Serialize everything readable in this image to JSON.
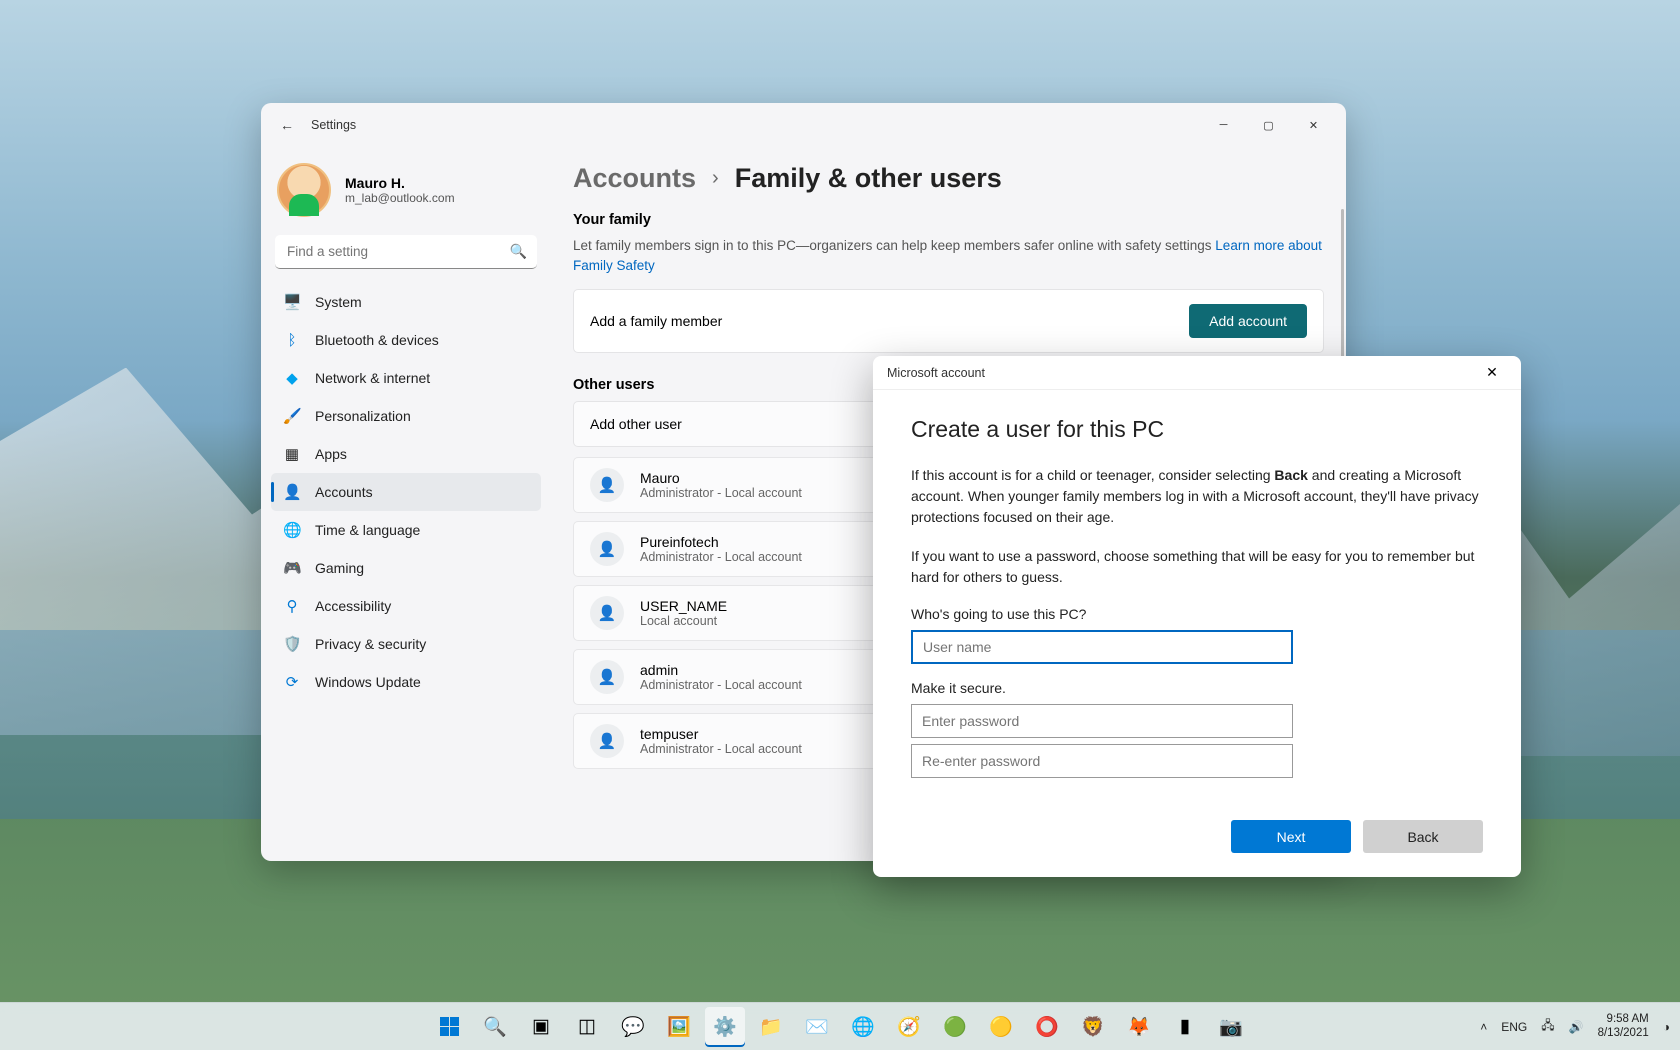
{
  "window": {
    "title": "Settings",
    "profile_name": "Mauro H.",
    "profile_email": "m_lab@outlook.com",
    "search_placeholder": "Find a setting"
  },
  "nav": {
    "system": "System",
    "bluetooth": "Bluetooth & devices",
    "network": "Network & internet",
    "personalization": "Personalization",
    "apps": "Apps",
    "accounts": "Accounts",
    "time": "Time & language",
    "gaming": "Gaming",
    "accessibility": "Accessibility",
    "privacy": "Privacy & security",
    "update": "Windows Update"
  },
  "main": {
    "crumb1": "Accounts",
    "crumb2": "Family & other users",
    "family_title": "Your family",
    "family_desc": "Let family members sign in to this PC—organizers can help keep members safer online with safety settings  ",
    "family_link": "Learn more about Family Safety",
    "add_family_label": "Add a family member",
    "add_account_btn": "Add account",
    "other_title": "Other users",
    "add_other_label": "Add other user",
    "users": [
      {
        "name": "Mauro",
        "role": "Administrator - Local account"
      },
      {
        "name": "Pureinfotech",
        "role": "Administrator - Local account"
      },
      {
        "name": "USER_NAME",
        "role": "Local account"
      },
      {
        "name": "admin",
        "role": "Administrator - Local account"
      },
      {
        "name": "tempuser",
        "role": "Administrator - Local account"
      }
    ]
  },
  "dialog": {
    "title": "Microsoft account",
    "heading": "Create a user for this PC",
    "p1a": "If this account is for a child or teenager, consider selecting ",
    "p1bold": "Back",
    "p1b": " and creating a Microsoft account. When younger family members log in with a Microsoft account, they'll have privacy protections focused on their age.",
    "p2": "If you want to use a password, choose something that will be easy for you to remember but hard for others to guess.",
    "q1": "Who's going to use this PC?",
    "username_placeholder": "User name",
    "q2": "Make it secure.",
    "password_placeholder": "Enter password",
    "password2_placeholder": "Re-enter password",
    "next": "Next",
    "back": "Back"
  },
  "tray": {
    "lang": "ENG",
    "time": "9:58 AM",
    "date": "8/13/2021"
  }
}
